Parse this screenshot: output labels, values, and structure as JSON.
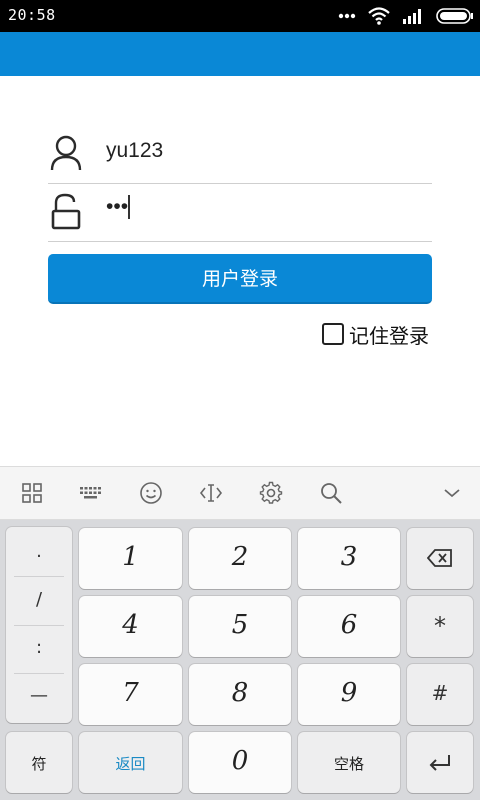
{
  "status_bar": {
    "time": "20:58"
  },
  "login": {
    "username": "yu123",
    "password_masked": "•••",
    "login_button": "用户登录",
    "remember_label": "记住登录",
    "remember_checked": false
  },
  "keyboard": {
    "toolbar_icons": [
      "grid-apps-icon",
      "keyboard-icon",
      "smiley-icon",
      "text-cursor-icon",
      "gear-icon",
      "search-icon",
      "chevron-down-icon"
    ],
    "symbols": [
      ".",
      "/",
      ":",
      "—"
    ],
    "digits": [
      "1",
      "2",
      "3",
      "4",
      "5",
      "6",
      "7",
      "8",
      "9",
      "0"
    ],
    "backspace_icon": "backspace-icon",
    "star": "*",
    "hash": "#",
    "symbols_key": "符",
    "back_key": "返回",
    "space_key": "空格",
    "enter_icon": "enter-icon"
  },
  "colors": {
    "primary": "#0a88d6",
    "back_key_text": "#1a8ac4"
  }
}
